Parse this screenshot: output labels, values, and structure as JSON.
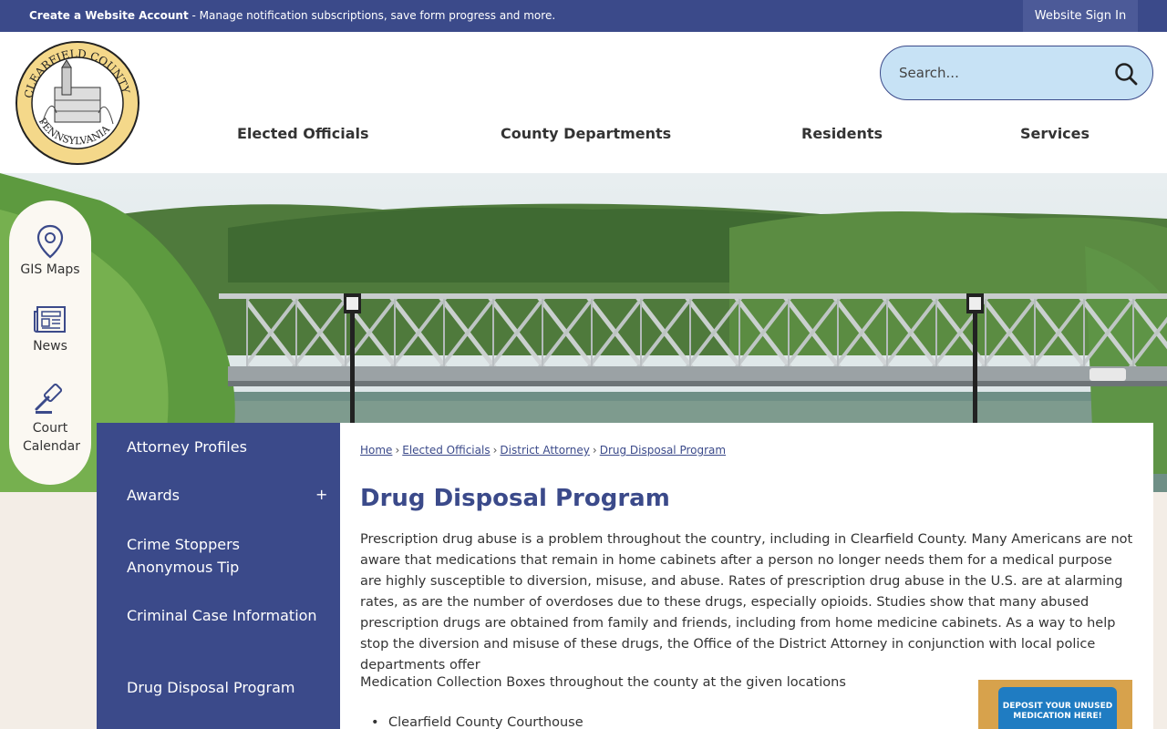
{
  "topbar": {
    "create_account": "Create a Website Account",
    "message": " - Manage notification subscriptions, save form progress and more.",
    "signin": "Website Sign In"
  },
  "logo": {
    "alt": "Clearfield County Pennsylvania seal"
  },
  "search": {
    "placeholder": "Search..."
  },
  "nav": [
    "Elected Officials",
    "County Departments",
    "Residents",
    "Services"
  ],
  "quick_links": [
    "GIS Maps",
    "News",
    "Court Calendar"
  ],
  "sidenav": {
    "items": [
      "Attorney Profiles",
      "Awards",
      "Crime Stoppers Anonymous Tip",
      "Criminal Case Information",
      "Drug Disposal Program"
    ],
    "expand": "+"
  },
  "breadcrumbs": [
    "Home",
    "Elected Officials",
    "District Attorney",
    "Drug Disposal Program"
  ],
  "page": {
    "title": "Drug Disposal Program",
    "paragraph": "Prescription drug abuse is a problem throughout the country, including in Clearfield County. Many Americans are not aware that medications that remain in home cabinets after a person no longer needs them for a medical purpose are highly susceptible to diversion, misuse, and abuse. Rates of prescription drug abuse in the U.S. are at alarming rates, as are the number of overdoses due to these drugs, especially opioids. Studies show that many abused prescription drugs are obtained from family and friends, including from home medicine cabinets. As a way to help stop the diversion and misuse of these drugs, the Office of the District Attorney in conjunction with local police departments offer",
    "paragraph2": "Medication Collection Boxes throughout the county at the given locations",
    "locations": [
      "Clearfield County Courthouse"
    ],
    "image_text": "DEPOSIT YOUR UNUSED MEDICATION HERE!"
  },
  "colors": {
    "primary": "#3b4a8a",
    "search_bg": "#c7e2f5",
    "page_bg": "#f3ede6"
  }
}
